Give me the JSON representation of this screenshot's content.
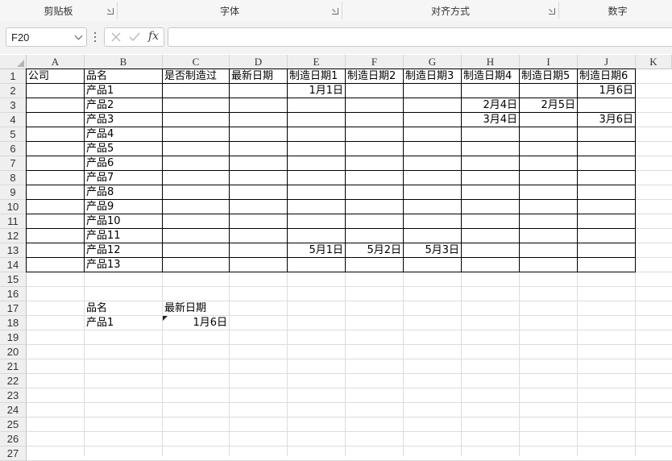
{
  "ribbon": {
    "groups": [
      {
        "label": "剪贴板",
        "launcher": true
      },
      {
        "label": "字体",
        "launcher": true
      },
      {
        "label": "对齐方式",
        "launcher": true
      },
      {
        "label": "数字",
        "launcher": false
      }
    ]
  },
  "formula_bar": {
    "name_box": "F20",
    "fx_label": "fx",
    "formula": ""
  },
  "sheet": {
    "columns": [
      "A",
      "B",
      "C",
      "D",
      "E",
      "F",
      "G",
      "H",
      "I",
      "J",
      "K"
    ],
    "rows": [
      "1",
      "2",
      "3",
      "4",
      "5",
      "6",
      "7",
      "8",
      "9",
      "10",
      "11",
      "12",
      "13",
      "14",
      "15",
      "16",
      "17",
      "18",
      "19",
      "20",
      "21",
      "22",
      "23",
      "24",
      "25",
      "26",
      "27"
    ],
    "selected_cell": "F20",
    "cells": [
      {
        "ref": "A1",
        "v": "公司",
        "align": "l"
      },
      {
        "ref": "B1",
        "v": "品名",
        "align": "l"
      },
      {
        "ref": "C1",
        "v": "是否制造过",
        "align": "l"
      },
      {
        "ref": "D1",
        "v": "最新日期",
        "align": "l"
      },
      {
        "ref": "E1",
        "v": "制造日期1",
        "align": "l"
      },
      {
        "ref": "F1",
        "v": "制造日期2",
        "align": "l"
      },
      {
        "ref": "G1",
        "v": "制造日期3",
        "align": "l"
      },
      {
        "ref": "H1",
        "v": "制造日期4",
        "align": "l"
      },
      {
        "ref": "I1",
        "v": "制造日期5",
        "align": "l"
      },
      {
        "ref": "J1",
        "v": "制造日期6",
        "align": "l"
      },
      {
        "ref": "B2",
        "v": "产品1",
        "align": "l"
      },
      {
        "ref": "E2",
        "v": "1月1日",
        "align": "r"
      },
      {
        "ref": "J2",
        "v": "1月6日",
        "align": "r"
      },
      {
        "ref": "B3",
        "v": "产品2",
        "align": "l"
      },
      {
        "ref": "H3",
        "v": "2月4日",
        "align": "r"
      },
      {
        "ref": "I3",
        "v": "2月5日",
        "align": "r"
      },
      {
        "ref": "B4",
        "v": "产品3",
        "align": "l"
      },
      {
        "ref": "H4",
        "v": "3月4日",
        "align": "r"
      },
      {
        "ref": "J4",
        "v": "3月6日",
        "align": "r"
      },
      {
        "ref": "B5",
        "v": "产品4",
        "align": "l"
      },
      {
        "ref": "B6",
        "v": "产品5",
        "align": "l"
      },
      {
        "ref": "B7",
        "v": "产品6",
        "align": "l"
      },
      {
        "ref": "B8",
        "v": "产品7",
        "align": "l"
      },
      {
        "ref": "B9",
        "v": "产品8",
        "align": "l"
      },
      {
        "ref": "B10",
        "v": "产品9",
        "align": "l"
      },
      {
        "ref": "B11",
        "v": "产品10",
        "align": "l"
      },
      {
        "ref": "B12",
        "v": "产品11",
        "align": "l"
      },
      {
        "ref": "B13",
        "v": "产品12",
        "align": "l"
      },
      {
        "ref": "E13",
        "v": "5月1日",
        "align": "r"
      },
      {
        "ref": "F13",
        "v": "5月2日",
        "align": "r"
      },
      {
        "ref": "G13",
        "v": "5月3日",
        "align": "r"
      },
      {
        "ref": "B14",
        "v": "产品13",
        "align": "l"
      },
      {
        "ref": "B17",
        "v": "品名",
        "align": "l"
      },
      {
        "ref": "C17",
        "v": "最新日期",
        "align": "l"
      },
      {
        "ref": "B18",
        "v": "产品1",
        "align": "l"
      },
      {
        "ref": "C18",
        "v": "1月6日",
        "align": "r",
        "error_marker": true
      }
    ]
  }
}
